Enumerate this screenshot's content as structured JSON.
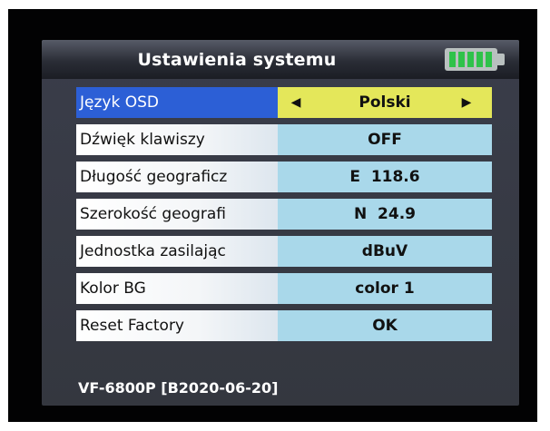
{
  "header": {
    "title": "Ustawienia systemu",
    "battery_icon": "battery-full-icon"
  },
  "settings": [
    {
      "label": "Język OSD",
      "value": "Polski",
      "selected": true
    },
    {
      "label": "Dźwięk klawiszy",
      "value": "OFF"
    },
    {
      "label": "Długość geograficz",
      "value": "E  118.6"
    },
    {
      "label": "Szerokość geografi",
      "value": "N  24.9"
    },
    {
      "label": "Jednostka zasilając",
      "value": "dBuV"
    },
    {
      "label": "Kolor BG",
      "value": "color 1"
    },
    {
      "label": "Reset Factory",
      "value": "OK"
    }
  ],
  "arrows": {
    "left": "◀",
    "right": "▶"
  },
  "footer": {
    "version": "VF-6800P [B2020-06-20]"
  },
  "colors": {
    "selected_label_bg": "#2c5fd6",
    "selected_value_bg": "#e4e75a",
    "value_bg": "#a9d8ea",
    "battery_green": "#2fc24a"
  }
}
